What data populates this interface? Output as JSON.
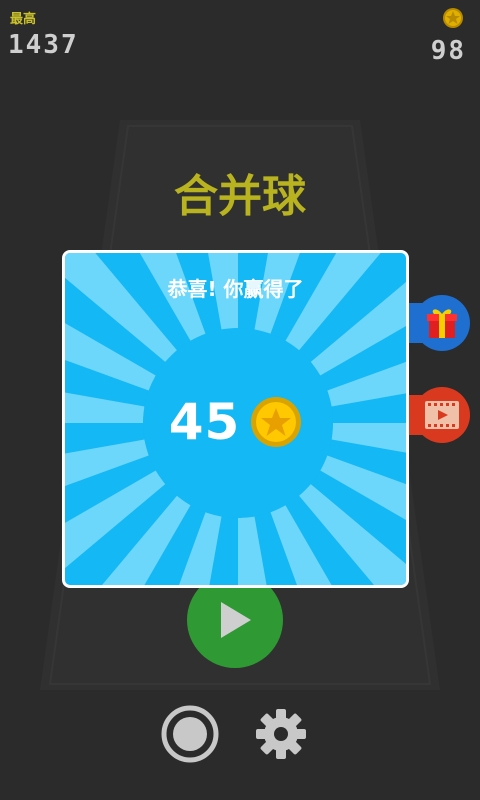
{
  "hud": {
    "best_label": "最高",
    "best_score": "1437",
    "coins": "98"
  },
  "game": {
    "title": "合并球"
  },
  "reward_dialog": {
    "title": "恭喜! 你赢得了",
    "amount": "45"
  },
  "icons": {
    "coin": "star-coin-icon",
    "gift": "gift-icon",
    "video": "film-play-icon",
    "play": "play-icon",
    "record": "record-icon",
    "settings": "gear-icon"
  },
  "colors": {
    "background": "#2b2b2b",
    "title": "#b8b31f",
    "dialog": "#13b8f5",
    "play_button": "#2f9a33",
    "gift_button": "#1e6fcf",
    "video_button": "#d93a1f",
    "coin": "#f2c200"
  }
}
